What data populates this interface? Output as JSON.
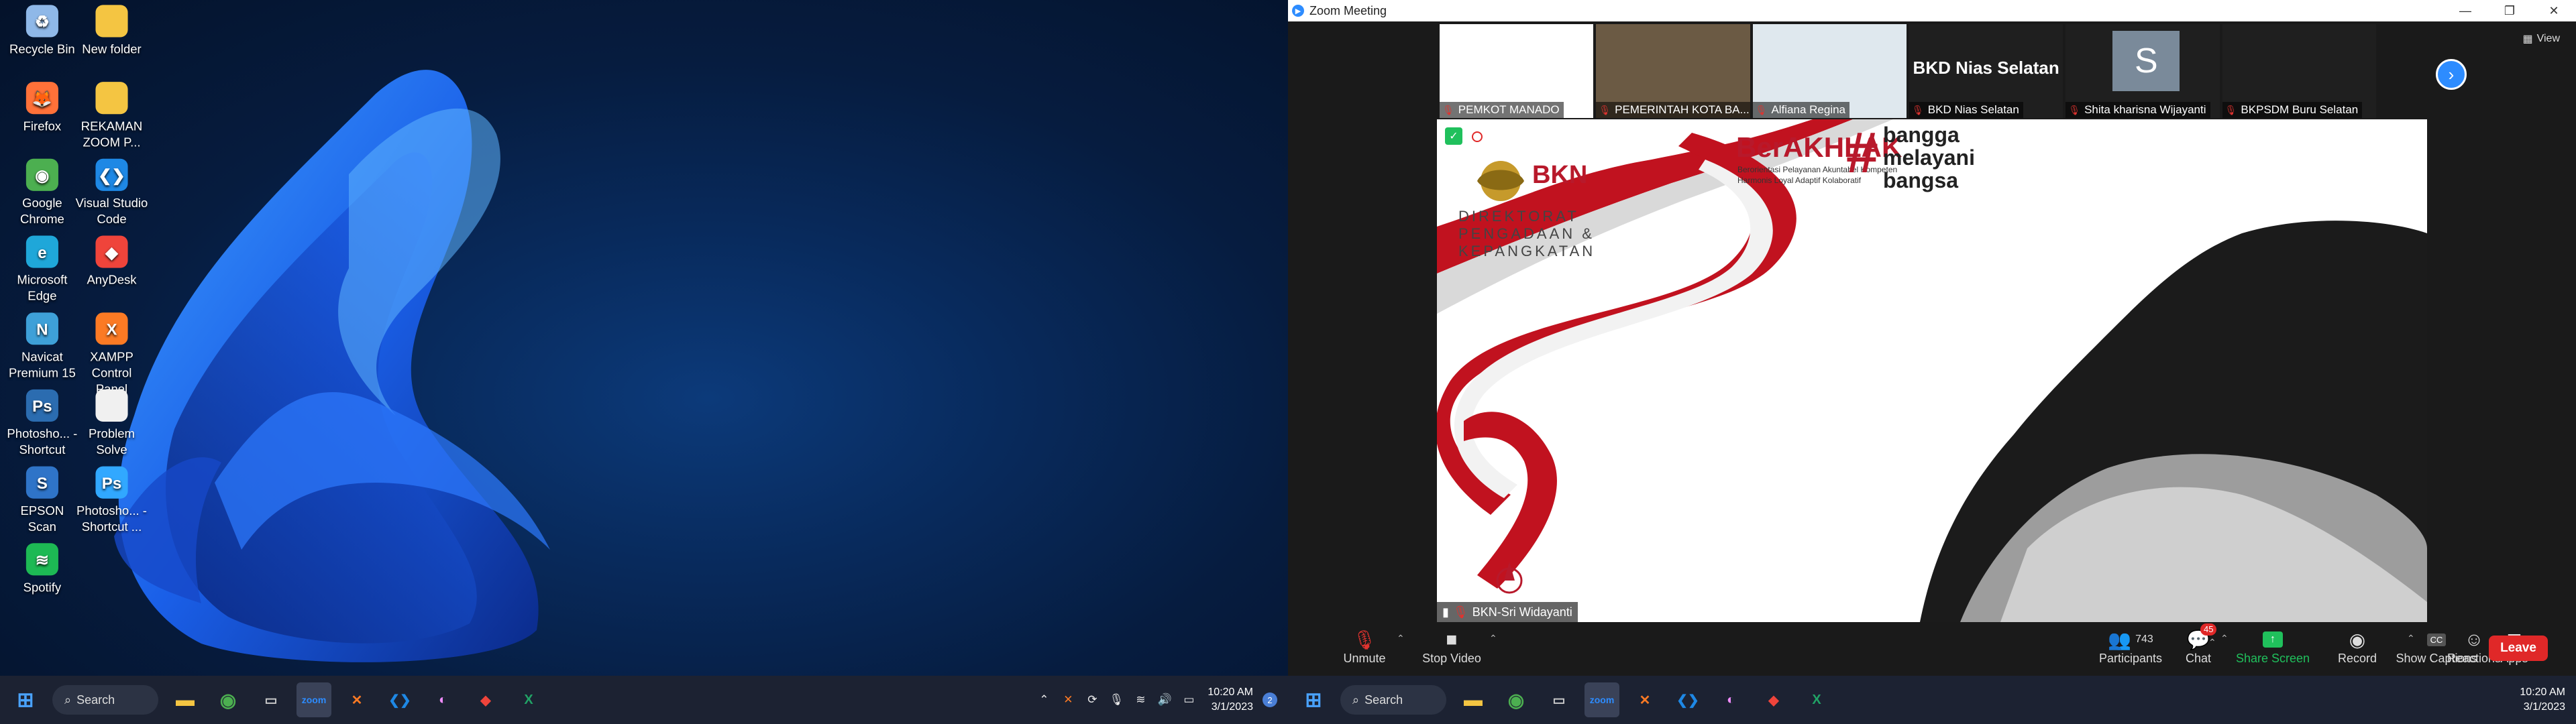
{
  "left": {
    "desktop_icons": [
      {
        "label": "Recycle Bin",
        "icon": "recycle-bin-icon",
        "color": "#8fb8e8",
        "glyph": "♻"
      },
      {
        "label": "New folder",
        "icon": "folder-icon",
        "color": "#f4c542",
        "glyph": ""
      },
      {
        "label": "Firefox",
        "icon": "firefox-icon",
        "color": "#ff7139",
        "glyph": "🦊"
      },
      {
        "label": "REKAMAN ZOOM P...",
        "icon": "folder-icon",
        "color": "#f4c542",
        "glyph": ""
      },
      {
        "label": "Google Chrome",
        "icon": "chrome-icon",
        "color": "#4caf50",
        "glyph": "◉"
      },
      {
        "label": "Visual Studio Code",
        "icon": "vscode-icon",
        "color": "#1e88e5",
        "glyph": "❮❯"
      },
      {
        "label": "Microsoft Edge",
        "icon": "edge-icon",
        "color": "#1fa7d9",
        "glyph": "e"
      },
      {
        "label": "AnyDesk",
        "icon": "anydesk-icon",
        "color": "#ef443b",
        "glyph": "◆"
      },
      {
        "label": "Navicat Premium 15",
        "icon": "navicat-icon",
        "color": "#3ea0d8",
        "glyph": "N"
      },
      {
        "label": "XAMPP Control Panel",
        "icon": "xampp-icon",
        "color": "#fb7a24",
        "glyph": "X"
      },
      {
        "label": "Photosho... - Shortcut",
        "icon": "shortcut-icon",
        "color": "#2b6cb0",
        "glyph": "Ps"
      },
      {
        "label": "Problem Solve",
        "icon": "document-icon",
        "color": "#f0f0f0",
        "glyph": ""
      },
      {
        "label": "EPSON Scan",
        "icon": "epson-icon",
        "color": "#2f74c8",
        "glyph": "S"
      },
      {
        "label": "Photosho... - Shortcut ...",
        "icon": "photoshop-icon",
        "color": "#31a8ff",
        "glyph": "Ps"
      },
      {
        "label": "Spotify",
        "icon": "spotify-icon",
        "color": "#1db954",
        "glyph": "≋"
      }
    ],
    "taskbar": {
      "search_label": "Search",
      "time": "10:20 AM",
      "date": "3/1/2023",
      "notif_count": "2"
    }
  },
  "zoom": {
    "window_title": "Zoom Meeting",
    "view_label": "View",
    "participants_strip": [
      {
        "name": "PEMKOT MANADO",
        "bg": "#ffffff"
      },
      {
        "name": "PEMERINTAH KOTA BA...",
        "bg": "#6b5a44"
      },
      {
        "name": "Alfiana Regina",
        "bg": "#dfe8ee"
      },
      {
        "name": "BKD Nias Selatan",
        "bg": "#1f1f1f",
        "big": "BKD Nias Selatan"
      },
      {
        "name": "Shita kharisna Wijayanti",
        "bg": "#1f1f1f",
        "avatar": "S"
      },
      {
        "name": "BKPSDM Buru Selatan",
        "bg": "#1f1f1f"
      }
    ],
    "shared_content": {
      "logo_text": "BKN",
      "dept_line1": "DIREKTORAT",
      "dept_line2": "PENGADAAN &",
      "dept_line3": "KEPANGKATAN",
      "berakhlak": "BerAKHLAK",
      "berakhlak_sub1": "Berorientasi Pelayanan Akuntabel Kompeten",
      "berakhlak_sub2": "Harmonis Loyal Adaptif Kolaboratif",
      "hashtag": "#",
      "bangga1": "bangga",
      "bangga2": "melayani",
      "bangga3": "bangsa",
      "speaker_label": "BKN-Sri Widayanti"
    },
    "toolbar": {
      "unmute": "Unmute",
      "stop_video": "Stop Video",
      "participants": "Participants",
      "participant_count": "743",
      "chat": "Chat",
      "chat_badge": "45",
      "share_screen": "Share Screen",
      "record": "Record",
      "show_captions": "Show Captions",
      "reactions": "Reactions",
      "apps": "Apps",
      "leave": "Leave",
      "cc": "CC"
    },
    "taskbar": {
      "search_label": "Search",
      "time": "10:20 AM",
      "date": "3/1/2023"
    }
  },
  "colors": {
    "zoom_blue": "#2d8cff",
    "leave_red": "#e02828",
    "share_green": "#20c05c",
    "bkn_red": "#b8192b"
  }
}
